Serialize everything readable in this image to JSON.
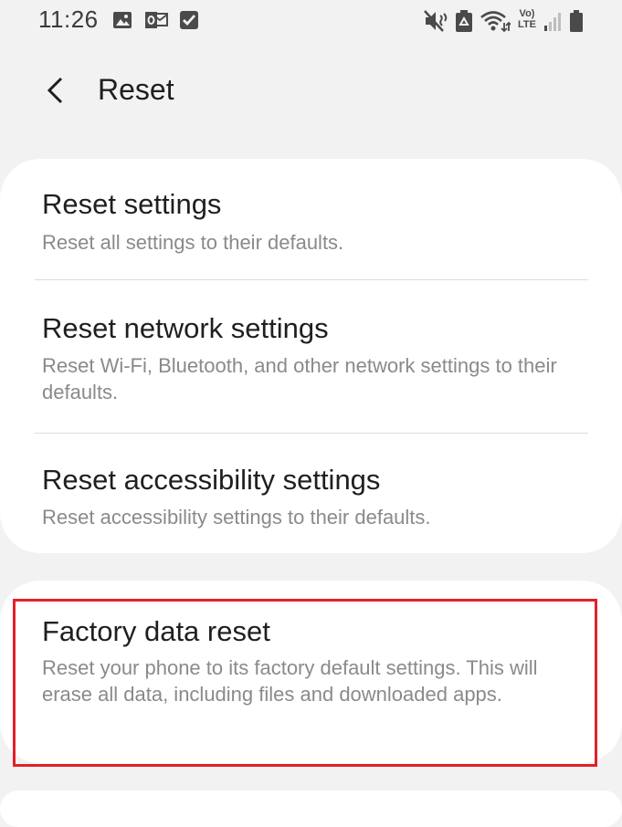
{
  "status_bar": {
    "time": "11:26",
    "lte_label": "Vo) LTE",
    "icons": [
      "image-icon",
      "outlook-icon",
      "check-box-icon",
      "mute-icon",
      "battery-saver-icon",
      "wifi-icon",
      "volte-icon",
      "signal-icon",
      "battery-icon"
    ]
  },
  "header": {
    "back_icon": "chevron-left-icon",
    "title": "Reset"
  },
  "items": [
    {
      "title": "Reset settings",
      "description": "Reset all settings to their defaults."
    },
    {
      "title": "Reset network settings",
      "description": "Reset Wi-Fi, Bluetooth, and other network settings to their defaults."
    },
    {
      "title": "Reset accessibility settings",
      "description": "Reset accessibility settings to their defaults."
    },
    {
      "title": "Factory data reset",
      "description": "Reset your phone to its factory default settings. This will erase all data, including files and downloaded apps."
    }
  ],
  "colors": {
    "background": "#f2f2f2",
    "card": "#ffffff",
    "title_text": "#1f1f1f",
    "secondary_text": "#8a8a8a",
    "highlight": "#e2202a"
  }
}
